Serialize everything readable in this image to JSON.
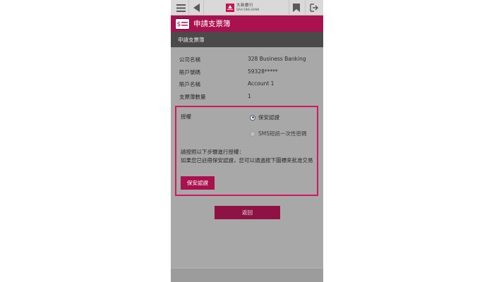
{
  "header": {
    "logo_cn": "大新銀行",
    "logo_en": "DAH SING BANK",
    "menu_icon": "hamburger-menu-icon",
    "back_icon": "back-arrow-icon",
    "bookmark_icon": "bookmark-icon",
    "logout_icon": "logout-icon"
  },
  "title": {
    "text": "申請支票簿",
    "icon": "cheque-icon"
  },
  "section": {
    "title": "申請支票簿"
  },
  "details": [
    {
      "label": "公司名稱",
      "value": "328 Business Banking"
    },
    {
      "label": "賬戶號碼",
      "value": "59328*****"
    },
    {
      "label": "賬戶名稱",
      "value": "Account 1"
    },
    {
      "label": "支票簿數量",
      "value": "1"
    }
  ],
  "authorization": {
    "label": "授權",
    "options": [
      {
        "label": "保安認證",
        "selected": true
      },
      {
        "label": "SMS短訊一次性密碼",
        "selected": false
      }
    ],
    "instruction_lines": [
      "請按照以下步驟進行授權：",
      "如果您已註冊保安認證，您可以通過按下圖標來批准交易"
    ],
    "button_label": "保安認證"
  },
  "return_button": "返回",
  "colors": {
    "brand": "#a9114f",
    "highlight_border": "#d2185f",
    "subheader": "#4a4a4a",
    "content_bg": "#a8a8a8"
  }
}
